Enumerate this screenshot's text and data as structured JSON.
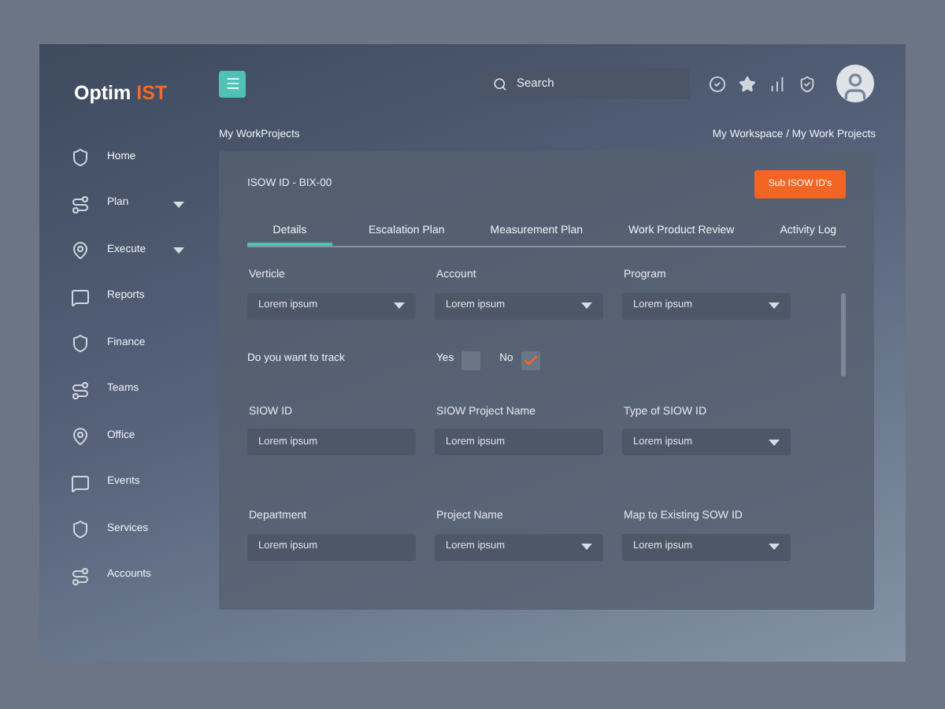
{
  "logo": {
    "main": "Optim",
    "accent": "IST"
  },
  "sidebar": {
    "items": [
      {
        "label": "Home",
        "expandable": false
      },
      {
        "label": "Plan",
        "expandable": true
      },
      {
        "label": "Execute",
        "expandable": true
      },
      {
        "label": "Reports",
        "expandable": false
      },
      {
        "label": "Finance",
        "expandable": false
      },
      {
        "label": "Teams",
        "expandable": false
      },
      {
        "label": "Office",
        "expandable": false
      },
      {
        "label": "Events",
        "expandable": false
      },
      {
        "label": "Services",
        "expandable": false
      },
      {
        "label": "Accounts",
        "expandable": false
      }
    ]
  },
  "search": {
    "placeholder": "Search"
  },
  "page_title": "My WorkProjects",
  "breadcrumb": "My Workspace / My Work Projects",
  "card": {
    "title": "ISOW ID - BIX-00",
    "button": "Sub ISOW ID's",
    "tabs": [
      {
        "label": "Details",
        "selected": true
      },
      {
        "label": "Escalation Plan",
        "selected": false
      },
      {
        "label": "Measurement Plan",
        "selected": false
      },
      {
        "label": "Work Product Review",
        "selected": false
      },
      {
        "label": "Activity Log",
        "selected": false
      }
    ],
    "rows": [
      {
        "kind": "fields",
        "fields": [
          {
            "label": "Verticle",
            "value": "Lorem ipsum",
            "kind": "select"
          },
          {
            "label": "Account",
            "value": "Lorem ipsum",
            "kind": "select"
          },
          {
            "label": "Program",
            "value": "Lorem ipsum",
            "kind": "select"
          }
        ]
      },
      {
        "kind": "track",
        "question": "Do you want to track",
        "options": [
          {
            "label": "Yes",
            "checked": false
          },
          {
            "label": "No",
            "checked": true
          }
        ]
      },
      {
        "kind": "fields",
        "fields": [
          {
            "label": "SIOW ID",
            "value": "Lorem ipsum",
            "kind": "text"
          },
          {
            "label": "SIOW Project Name",
            "value": "Lorem ipsum",
            "kind": "text"
          },
          {
            "label": "Type of SIOW ID",
            "value": "Lorem ipsum",
            "kind": "select"
          }
        ]
      },
      {
        "kind": "fields",
        "fields": [
          {
            "label": "Department",
            "value": "Lorem ipsum",
            "kind": "text"
          },
          {
            "label": "Project Name",
            "value": "Lorem ipsum",
            "kind": "select"
          },
          {
            "label": "Map to Existing SOW ID",
            "value": "Lorem ipsum",
            "kind": "select"
          }
        ]
      }
    ]
  }
}
